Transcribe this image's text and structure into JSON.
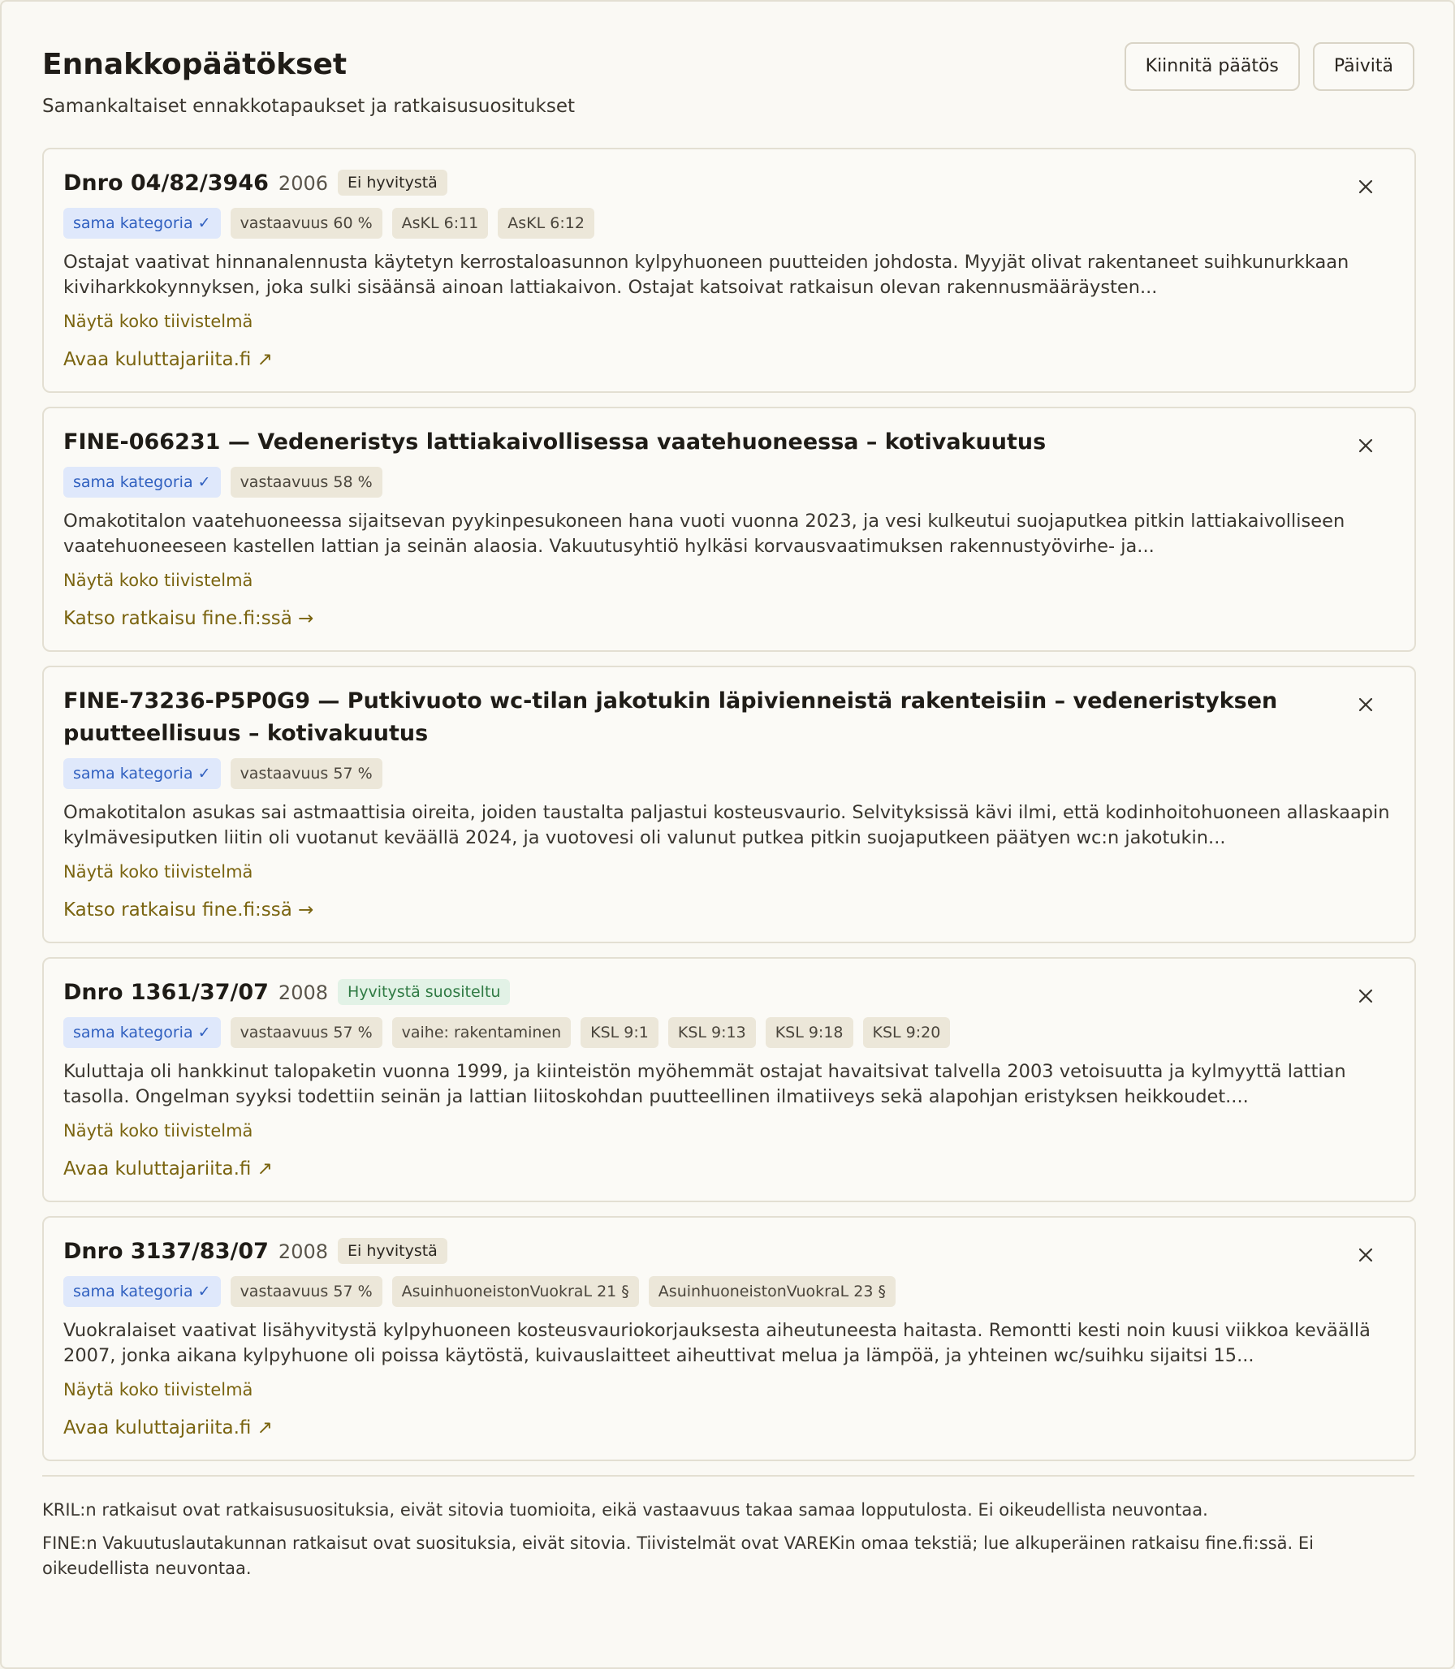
{
  "header": {
    "title": "Ennakkopäätökset",
    "subtitle": "Samankaltaiset ennakkotapaukset ja ratkaisusuositukset",
    "pin_label": "Kiinnitä päätös",
    "refresh_label": "Päivitä"
  },
  "cards": [
    {
      "title": "Dnro 04/82/3946",
      "year": "2006",
      "outcome": "Ei hyvitystä",
      "tags": [
        "sama kategoria ✓",
        "vastaavuus 60 %",
        "AsKL 6:11",
        "AsKL 6:12"
      ],
      "summary": "Ostajat vaativat hinnanalennusta käytetyn kerrostaloasunnon kylpyhuoneen puutteiden johdosta. Myyjät olivat rakentaneet suihkunurkkaan kiviharkkokynnyksen, joka sulki sisäänsä ainoan lattiakaivon. Ostajat katsoivat ratkaisun olevan rakennusmääräysten...",
      "expand_label": "Näytä koko tiivistelmä",
      "link_label": "Avaa kuluttajariita.fi ↗"
    },
    {
      "title": "FINE-066231 — Vedeneristys lattiakaivollisessa vaatehuoneessa – kotivakuutus",
      "year": "",
      "outcome": "",
      "tags": [
        "sama kategoria ✓",
        "vastaavuus 58 %"
      ],
      "summary": "Omakotitalon vaatehuoneessa sijaitsevan pyykinpesukoneen hana vuoti vuonna 2023, ja vesi kulkeutui suojaputkea pitkin lattiakaivolliseen vaatehuoneeseen kastellen lattian ja seinän alaosia. Vakuutusyhtiö hylkäsi korvausvaatimuksen rakennustyövirhe- ja...",
      "expand_label": "Näytä koko tiivistelmä",
      "link_label": "Katso ratkaisu fine.fi:ssä →"
    },
    {
      "title": "FINE-73236-P5P0G9 — Putkivuoto wc-tilan jakotukin läpivienneistä rakenteisiin – vedeneristyksen puutteellisuus – kotivakuutus",
      "year": "",
      "outcome": "",
      "tags": [
        "sama kategoria ✓",
        "vastaavuus 57 %"
      ],
      "summary": "Omakotitalon asukas sai astmaattisia oireita, joiden taustalta paljastui kosteusvaurio. Selvityksissä kävi ilmi, että kodinhoitohuoneen allaskaapin kylmävesiputken liitin oli vuotanut keväällä 2024, ja vuotovesi oli valunut putkea pitkin suojaputkeen päätyen wc:n jakotukin...",
      "expand_label": "Näytä koko tiivistelmä",
      "link_label": "Katso ratkaisu fine.fi:ssä →"
    },
    {
      "title": "Dnro 1361/37/07",
      "year": "2008",
      "outcome": "Hyvitystä suositeltu",
      "tags": [
        "sama kategoria ✓",
        "vastaavuus 57 %",
        "vaihe: rakentaminen",
        "KSL 9:1",
        "KSL 9:13",
        "KSL 9:18",
        "KSL 9:20"
      ],
      "summary": "Kuluttaja oli hankkinut talopaketin vuonna 1999, ja kiinteistön myöhemmät ostajat havaitsivat talvella 2003 vetoisuutta ja kylmyyttä lattian tasolla. Ongelman syyksi todettiin seinän ja lattian liitoskohdan puutteellinen ilmatiiveys sekä alapohjan eristyksen heikkoudet....",
      "expand_label": "Näytä koko tiivistelmä",
      "link_label": "Avaa kuluttajariita.fi ↗"
    },
    {
      "title": "Dnro 3137/83/07",
      "year": "2008",
      "outcome": "Ei hyvitystä",
      "tags": [
        "sama kategoria ✓",
        "vastaavuus 57 %",
        "AsuinhuoneistonVuokraL 21 §",
        "AsuinhuoneistonVuokraL 23 §"
      ],
      "summary": "Vuokralaiset vaativat lisähyvitystä kylpyhuoneen kosteusvauriokorjauksesta aiheutuneesta haitasta. Remontti kesti noin kuusi viikkoa keväällä 2007, jonka aikana kylpyhuone oli poissa käytöstä, kuivauslaitteet aiheuttivat melua ja lämpöä, ja yhteinen wc/suihku sijaitsi 15...",
      "expand_label": "Näytä koko tiivistelmä",
      "link_label": "Avaa kuluttajariita.fi ↗"
    }
  ],
  "disclaimers": [
    "KRIL:n ratkaisut ovat ratkaisusuosituksia, eivät sitovia tuomioita, eikä vastaavuus takaa samaa lopputulosta. Ei oikeudellista neuvontaa.",
    "FINE:n Vakuutuslautakunnan ratkaisut ovat suosituksia, eivät sitovia. Tiivistelmät ovat VAREKin omaa tekstiä; lue alkuperäinen ratkaisu fine.fi:ssä. Ei oikeudellista neuvontaa."
  ],
  "icons": {
    "close": "close-icon"
  },
  "colors": {
    "accent_link": "#7a6410",
    "category_tag": "#2f5fbf",
    "positive_badge": "#2f7a43"
  }
}
